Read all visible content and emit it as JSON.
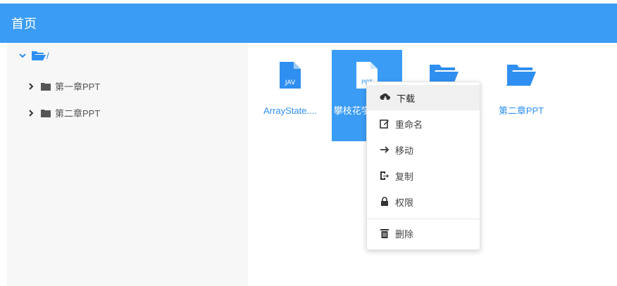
{
  "header": {
    "title": "首页"
  },
  "sidebar": {
    "root_label": "/",
    "items": [
      {
        "label": "第一章PPT"
      },
      {
        "label": "第二章PPT"
      }
    ]
  },
  "files": [
    {
      "name": "ArrayState....",
      "type": "file",
      "badge": "JAV"
    },
    {
      "name": "攀枝花学 毕业设",
      "type": "file",
      "badge": "PPT"
    },
    {
      "name": "",
      "type": "folder"
    },
    {
      "name": "第二章PPT",
      "type": "folder"
    }
  ],
  "context_menu": {
    "items": [
      {
        "label": "下载",
        "icon": "cloud-download-icon"
      },
      {
        "label": "重命名",
        "icon": "edit-icon"
      },
      {
        "label": "移动",
        "icon": "arrow-right-icon"
      },
      {
        "label": "复制",
        "icon": "copy-icon"
      },
      {
        "label": "权限",
        "icon": "lock-icon"
      },
      {
        "label": "删除",
        "icon": "trash-icon"
      }
    ]
  },
  "colors": {
    "primary": "#3a9cf5",
    "link": "#2f8ff0"
  }
}
